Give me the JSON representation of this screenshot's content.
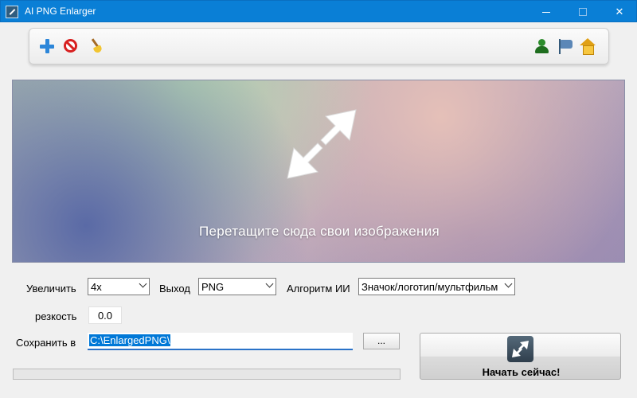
{
  "window": {
    "title": "AI PNG Enlarger"
  },
  "icons": {
    "add": "plus-icon",
    "remove": "no-entry-icon",
    "clear": "broom-icon",
    "account": "user-icon",
    "language": "flag-icon",
    "home": "home-icon",
    "drop": "diagonal-resize-arrow-icon",
    "start": "enlarge-icon"
  },
  "colors": {
    "titlebar": "#0a7fd6",
    "accent": "#2a72c8",
    "selection": "#0078d7"
  },
  "dropzone": {
    "text": "Перетащите сюда свои изображения"
  },
  "settings": {
    "scale_label": "Увеличить",
    "scale_value": "4x",
    "output_label": "Выход",
    "output_value": "PNG",
    "algorithm_label": "Алгоритм ИИ",
    "algorithm_value": "Значок/логотип/мультфильм",
    "sharpness_label": "резкость",
    "sharpness_value": "0.0"
  },
  "save": {
    "label": "Сохранить в",
    "path": "C:\\EnlargedPNG\\",
    "browse_label": "..."
  },
  "progress": {
    "percent": 0
  },
  "start": {
    "label": "Начать сейчас!"
  }
}
